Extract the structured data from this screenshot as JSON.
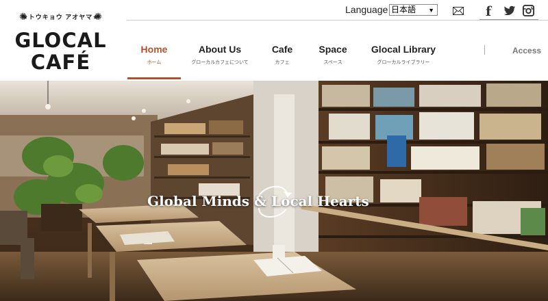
{
  "logo": {
    "kana": "★トウキョウ アオヤマ★",
    "line1": "GLOCAL",
    "line2": "CAFÉ"
  },
  "language": {
    "label": "Language",
    "selected": "日本語"
  },
  "social": {
    "facebook": "f"
  },
  "nav": {
    "items": [
      {
        "en": "Home",
        "jp": "ホーム"
      },
      {
        "en": "About Us",
        "jp": "グローカルカフェについて"
      },
      {
        "en": "Cafe",
        "jp": "カフェ"
      },
      {
        "en": "Space",
        "jp": "スペース"
      },
      {
        "en": "Glocal Library",
        "jp": "グローカルライブラリー"
      }
    ],
    "access": "Access"
  },
  "hero": {
    "tagline": "Global Minds & Local Hearts"
  },
  "colors": {
    "accent": "#b3502b"
  }
}
